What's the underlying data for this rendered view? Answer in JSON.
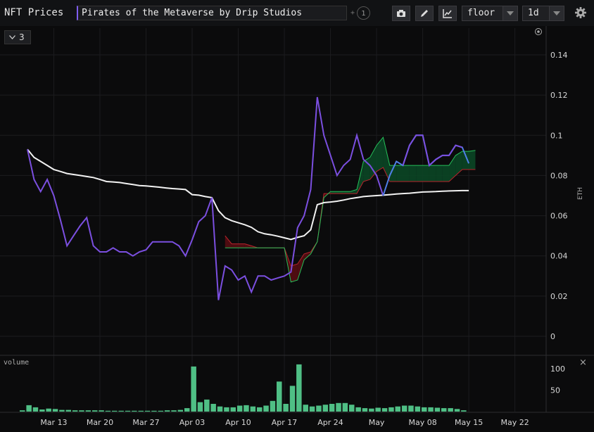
{
  "header": {
    "title": "NFT Prices",
    "collection": "Pirates of the Metaverse by Drip Studios",
    "plus": "+",
    "count": "1",
    "metric": "floor",
    "interval": "1d"
  },
  "layers_count": "3",
  "volume_label": "volume",
  "close_label": "×",
  "y_unit": "ETH",
  "colors": {
    "background": "#0b0b0c",
    "floor_line": "#7b4fe0",
    "average_line": "#f2f2f2",
    "band_upper": "#26c05a",
    "band_lower": "#b8242c",
    "band_fill_up": "#0b4a27",
    "band_fill_down": "#5a0d13",
    "volume_bar": "#4fbf85"
  },
  "chart_data": [
    {
      "type": "line",
      "ylabel": "ETH",
      "ylim": [
        0,
        0.14
      ],
      "yticks": [
        "0",
        "0.02",
        "0.04",
        "0.06",
        "0.08",
        "0.1",
        "0.12",
        "0.14"
      ],
      "xticks": [
        "Mar 13",
        "Mar 20",
        "Mar 27",
        "Apr 03",
        "Apr 10",
        "Apr 17",
        "Apr 24",
        "May",
        "May 08",
        "May 15",
        "May 22"
      ],
      "x_start": "Mar 09",
      "grid": true,
      "series": [
        {
          "key": "floor",
          "values": [
            [
              0,
              0.093
            ],
            [
              1,
              0.078
            ],
            [
              2,
              0.072
            ],
            [
              3,
              0.078
            ],
            [
              4,
              0.07
            ],
            [
              5,
              0.058
            ],
            [
              6,
              0.045
            ],
            [
              7,
              0.05
            ],
            [
              8,
              0.055
            ],
            [
              9,
              0.059
            ],
            [
              10,
              0.045
            ],
            [
              11,
              0.042
            ],
            [
              12,
              0.042
            ],
            [
              13,
              0.044
            ],
            [
              14,
              0.042
            ],
            [
              15,
              0.042
            ],
            [
              16,
              0.04
            ],
            [
              17,
              0.042
            ],
            [
              18,
              0.043
            ],
            [
              19,
              0.047
            ],
            [
              20,
              0.047
            ],
            [
              21,
              0.047
            ],
            [
              22,
              0.047
            ],
            [
              23,
              0.045
            ],
            [
              24,
              0.04
            ],
            [
              25,
              0.048
            ],
            [
              26,
              0.057
            ],
            [
              27,
              0.06
            ],
            [
              28,
              0.069
            ],
            [
              29,
              0.018
            ],
            [
              30,
              0.035
            ],
            [
              31,
              0.033
            ],
            [
              32,
              0.028
            ],
            [
              33,
              0.03
            ],
            [
              34,
              0.022
            ],
            [
              35,
              0.03
            ],
            [
              36,
              0.03
            ],
            [
              37,
              0.028
            ],
            [
              38,
              0.029
            ],
            [
              39,
              0.03
            ],
            [
              40,
              0.032
            ],
            [
              41,
              0.054
            ],
            [
              42,
              0.06
            ],
            [
              43,
              0.073
            ],
            [
              44,
              0.119
            ],
            [
              45,
              0.1
            ],
            [
              46,
              0.09
            ],
            [
              47,
              0.08
            ],
            [
              48,
              0.085
            ],
            [
              49,
              0.088
            ],
            [
              50,
              0.1
            ],
            [
              51,
              0.088
            ],
            [
              52,
              0.085
            ],
            [
              53,
              0.08
            ],
            [
              54,
              0.07
            ],
            [
              55,
              0.08
            ],
            [
              56,
              0.087
            ],
            [
              57,
              0.085
            ],
            [
              58,
              0.095
            ],
            [
              59,
              0.1
            ],
            [
              60,
              0.1
            ],
            [
              61,
              0.085
            ],
            [
              62,
              0.088
            ],
            [
              63,
              0.09
            ],
            [
              64,
              0.09
            ],
            [
              65,
              0.095
            ],
            [
              66,
              0.094
            ],
            [
              67,
              0.086
            ]
          ]
        },
        {
          "key": "average",
          "values": [
            [
              0,
              0.093
            ],
            [
              1,
              0.089
            ],
            [
              2,
              0.087
            ],
            [
              3,
              0.085
            ],
            [
              4,
              0.083
            ],
            [
              5,
              0.082
            ],
            [
              6,
              0.081
            ],
            [
              7,
              0.0805
            ],
            [
              8,
              0.08
            ],
            [
              9,
              0.0795
            ],
            [
              10,
              0.079
            ],
            [
              11,
              0.078
            ],
            [
              12,
              0.077
            ],
            [
              13,
              0.0768
            ],
            [
              14,
              0.0765
            ],
            [
              15,
              0.076
            ],
            [
              16,
              0.0755
            ],
            [
              17,
              0.075
            ],
            [
              18,
              0.0748
            ],
            [
              19,
              0.0745
            ],
            [
              20,
              0.0742
            ],
            [
              21,
              0.0738
            ],
            [
              22,
              0.0735
            ],
            [
              23,
              0.0733
            ],
            [
              24,
              0.073
            ],
            [
              25,
              0.0705
            ],
            [
              26,
              0.0702
            ],
            [
              27,
              0.0695
            ],
            [
              28,
              0.069
            ],
            [
              29,
              0.0625
            ],
            [
              30,
              0.059
            ],
            [
              31,
              0.0575
            ],
            [
              32,
              0.0565
            ],
            [
              33,
              0.0555
            ],
            [
              34,
              0.0542
            ],
            [
              35,
              0.052
            ],
            [
              36,
              0.051
            ],
            [
              37,
              0.0505
            ],
            [
              38,
              0.0498
            ],
            [
              39,
              0.049
            ],
            [
              40,
              0.0482
            ],
            [
              41,
              0.0492
            ],
            [
              42,
              0.05
            ],
            [
              43,
              0.053
            ],
            [
              44,
              0.0655
            ],
            [
              45,
              0.0665
            ],
            [
              46,
              0.0668
            ],
            [
              47,
              0.0672
            ],
            [
              48,
              0.0678
            ],
            [
              49,
              0.0685
            ],
            [
              50,
              0.069
            ],
            [
              51,
              0.0695
            ],
            [
              52,
              0.0698
            ],
            [
              53,
              0.07
            ],
            [
              54,
              0.0702
            ],
            [
              55,
              0.0705
            ],
            [
              56,
              0.0708
            ],
            [
              57,
              0.071
            ],
            [
              58,
              0.0712
            ],
            [
              59,
              0.0715
            ],
            [
              60,
              0.0718
            ],
            [
              61,
              0.0719
            ],
            [
              62,
              0.072
            ],
            [
              63,
              0.0722
            ],
            [
              64,
              0.0723
            ],
            [
              65,
              0.0724
            ],
            [
              66,
              0.0725
            ],
            [
              67,
              0.0725
            ]
          ]
        },
        {
          "key": "band_upper",
          "values": [
            [
              30,
              0.044
            ],
            [
              31,
              0.044
            ],
            [
              32,
              0.044
            ],
            [
              33,
              0.044
            ],
            [
              34,
              0.044
            ],
            [
              35,
              0.044
            ],
            [
              36,
              0.044
            ],
            [
              37,
              0.044
            ],
            [
              38,
              0.044
            ],
            [
              39,
              0.044
            ],
            [
              40,
              0.027
            ],
            [
              41,
              0.028
            ],
            [
              42,
              0.038
            ],
            [
              43,
              0.041
            ],
            [
              44,
              0.047
            ],
            [
              45,
              0.069
            ],
            [
              46,
              0.072
            ],
            [
              47,
              0.072
            ],
            [
              48,
              0.072
            ],
            [
              49,
              0.072
            ],
            [
              50,
              0.073
            ],
            [
              51,
              0.087
            ],
            [
              52,
              0.089
            ],
            [
              53,
              0.095
            ],
            [
              54,
              0.099
            ],
            [
              55,
              0.085
            ],
            [
              56,
              0.085
            ],
            [
              57,
              0.085
            ],
            [
              58,
              0.085
            ],
            [
              59,
              0.085
            ],
            [
              60,
              0.085
            ],
            [
              61,
              0.085
            ],
            [
              62,
              0.085
            ],
            [
              63,
              0.085
            ],
            [
              64,
              0.085
            ],
            [
              65,
              0.09
            ],
            [
              66,
              0.092
            ],
            [
              67,
              0.092
            ],
            [
              68,
              0.0925
            ]
          ]
        },
        {
          "key": "band_lower",
          "values": [
            [
              30,
              0.05
            ],
            [
              31,
              0.046
            ],
            [
              32,
              0.046
            ],
            [
              33,
              0.046
            ],
            [
              34,
              0.045
            ],
            [
              35,
              0.044
            ],
            [
              36,
              0.044
            ],
            [
              37,
              0.044
            ],
            [
              38,
              0.044
            ],
            [
              39,
              0.044
            ],
            [
              40,
              0.035
            ],
            [
              41,
              0.036
            ],
            [
              42,
              0.041
            ],
            [
              43,
              0.042
            ],
            [
              44,
              0.047
            ],
            [
              45,
              0.071
            ],
            [
              46,
              0.071
            ],
            [
              47,
              0.071
            ],
            [
              48,
              0.071
            ],
            [
              49,
              0.071
            ],
            [
              50,
              0.071
            ],
            [
              51,
              0.077
            ],
            [
              52,
              0.078
            ],
            [
              53,
              0.082
            ],
            [
              54,
              0.084
            ],
            [
              55,
              0.077
            ],
            [
              56,
              0.077
            ],
            [
              57,
              0.077
            ],
            [
              58,
              0.077
            ],
            [
              59,
              0.077
            ],
            [
              60,
              0.077
            ],
            [
              61,
              0.077
            ],
            [
              62,
              0.077
            ],
            [
              63,
              0.077
            ],
            [
              64,
              0.077
            ],
            [
              65,
              0.08
            ],
            [
              66,
              0.083
            ],
            [
              67,
              0.083
            ],
            [
              68,
              0.083
            ]
          ]
        }
      ]
    },
    {
      "type": "bar",
      "ylabel": "volume",
      "ylim": [
        0,
        120
      ],
      "yticks": [
        "50",
        "100"
      ],
      "values": [
        3,
        15,
        10,
        5,
        7,
        6,
        4,
        4,
        3,
        3,
        3,
        3,
        3,
        2,
        2,
        2,
        2,
        2,
        2,
        2,
        2,
        2,
        3,
        3,
        4,
        8,
        105,
        22,
        28,
        18,
        12,
        10,
        10,
        14,
        15,
        12,
        10,
        14,
        25,
        70,
        18,
        60,
        110,
        16,
        12,
        14,
        16,
        18,
        20,
        20,
        16,
        10,
        8,
        7,
        9,
        8,
        10,
        12,
        14,
        14,
        12,
        10,
        10,
        9,
        8,
        8,
        6,
        3
      ]
    }
  ]
}
